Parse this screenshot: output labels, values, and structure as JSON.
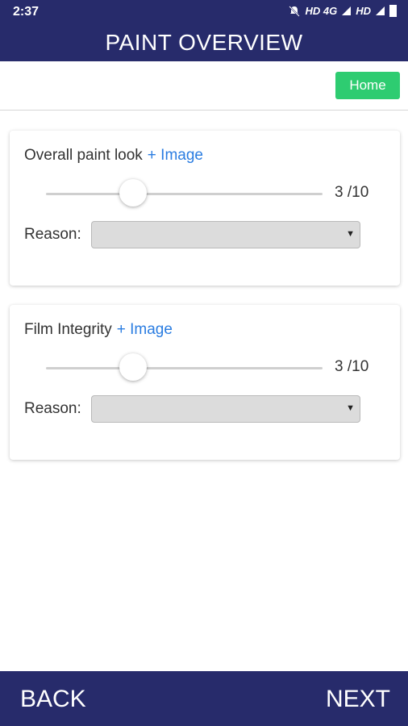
{
  "status_bar": {
    "time": "2:37",
    "network_1": "HD 4G",
    "network_2": "HD"
  },
  "app_bar": {
    "title": "PAINT OVERVIEW"
  },
  "header": {
    "home_label": "Home"
  },
  "cards": [
    {
      "title": "Overall paint look",
      "image_link": "+ Image",
      "score_text": "3 /10",
      "score": 3,
      "max": 10,
      "reason_label": "Reason:",
      "reason_value": ""
    },
    {
      "title": "Film Integrity",
      "image_link": "+ Image",
      "score_text": "3 /10",
      "score": 3,
      "max": 10,
      "reason_label": "Reason:",
      "reason_value": ""
    }
  ],
  "footer": {
    "back_label": "BACK",
    "next_label": "NEXT"
  },
  "colors": {
    "primary": "#272b6b",
    "home_button": "#2ecc71",
    "link": "#2b7de1"
  }
}
